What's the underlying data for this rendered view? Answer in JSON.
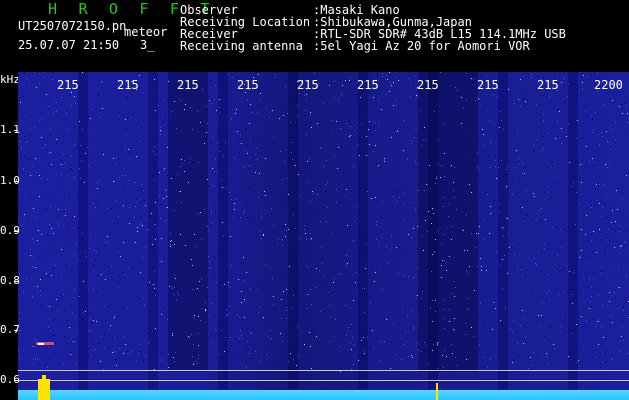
{
  "header": {
    "title": "H R O F F T",
    "filename": "UT2507072150.pn",
    "tag": "meteor",
    "datetime": "25.07.07 21:50",
    "count": "3_",
    "labels": [
      "Observer",
      "Receiving Location",
      "Receiver",
      "Receiving antenna"
    ],
    "values": [
      ":Masaki Kano",
      ":Shibukawa,Gunma,Japan",
      ":RTL-SDR SDR# 43dB L15 114.1MHz USB",
      ":5el Yagi Az 20 for Aomori VOR"
    ]
  },
  "axis": {
    "y_unit": "kHz",
    "y_ticks": [
      "1.1",
      "1.0",
      "0.9",
      "0.8",
      "0.7",
      "0.6"
    ],
    "x_ticks": [
      "215",
      "215",
      "215",
      "215",
      "215",
      "215",
      "215",
      "215",
      "215",
      "2200"
    ]
  },
  "colors": {
    "title": "#21c41f",
    "background": "#1b1fa0",
    "noise_floor": "#25c4ff",
    "meteor_echo": "#ffe400"
  }
}
